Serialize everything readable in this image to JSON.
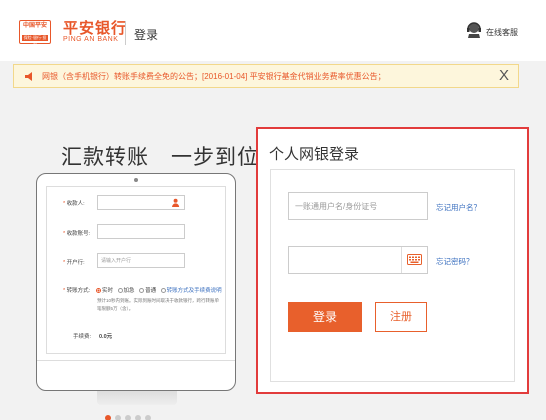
{
  "header": {
    "logo_top_text": "中国平安",
    "logo_bottom_text": "保险·银行·投资",
    "bank_name": "平安银行",
    "bank_name_en": "PING AN BANK",
    "page_title": "登录",
    "online_service_label": "在线客服"
  },
  "notice": {
    "text": "网银（含手机银行）转账手续费全免的公告；[2016-01-04] 平安银行基金代销业务费率优惠公告；",
    "close_label": "X"
  },
  "promo": {
    "slogan": "汇款转账　一步到位",
    "form": {
      "payer_label": "收款人:",
      "account_label": "收款账号:",
      "branch_label": "开户行:",
      "branch_placeholder": "请输入开户行",
      "method_label": "转账方式:",
      "method_options": [
        "实时",
        "加急",
        "普通"
      ],
      "method_link": "转账方式及手续费说明",
      "note": "预计10秒内到账。实际到账时间取决于收款银行，跨行转账单笔限额5万（含）。",
      "fee_label": "手续费:",
      "fee_value": "0.0元"
    }
  },
  "login": {
    "title": "个人网银登录",
    "username_placeholder": "一账通用户名/身份证号",
    "forgot_username": "忘记用户名？",
    "password_placeholder": "",
    "forgot_password": "忘记密码？",
    "login_button": "登录",
    "register_button": "注册"
  },
  "colors": {
    "brand": "#e8572a",
    "panel_border": "#e23c3c",
    "link": "#3a6fbf"
  }
}
